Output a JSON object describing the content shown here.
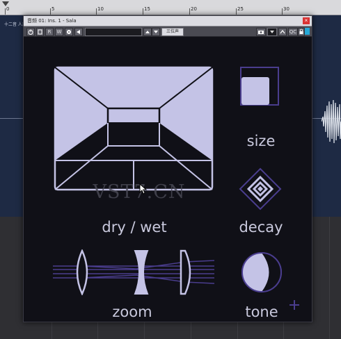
{
  "ruler": {
    "marks": [
      {
        "label": "0"
      },
      {
        "label": "5"
      },
      {
        "label": "10"
      },
      {
        "label": "15"
      },
      {
        "label": "20"
      },
      {
        "label": "25"
      },
      {
        "label": "30"
      }
    ]
  },
  "track": {
    "label": "十二音 人声"
  },
  "window": {
    "title": "音频 01: Ins. 1 - Sala",
    "close_label": "×"
  },
  "toolbar": {
    "read_label": "R",
    "write_label": "W",
    "preset_value": "",
    "program_label": "三位声",
    "qc_label": "QC"
  },
  "plugin": {
    "controls": {
      "dry_wet": "dry / wet",
      "size": "size",
      "decay": "decay",
      "zoom": "zoom",
      "tone": "tone"
    },
    "watermark": "VST7.CN"
  },
  "colors": {
    "accent": "#c4c3e6",
    "outline": "#4a3d8e",
    "panel_bg": "#101017",
    "label": "#c9c9dd"
  },
  "icons": [
    "power-icon",
    "bypass-icon",
    "preset-icon",
    "arrow-icon",
    "camera-icon",
    "settings-icon",
    "plus-icon"
  ]
}
